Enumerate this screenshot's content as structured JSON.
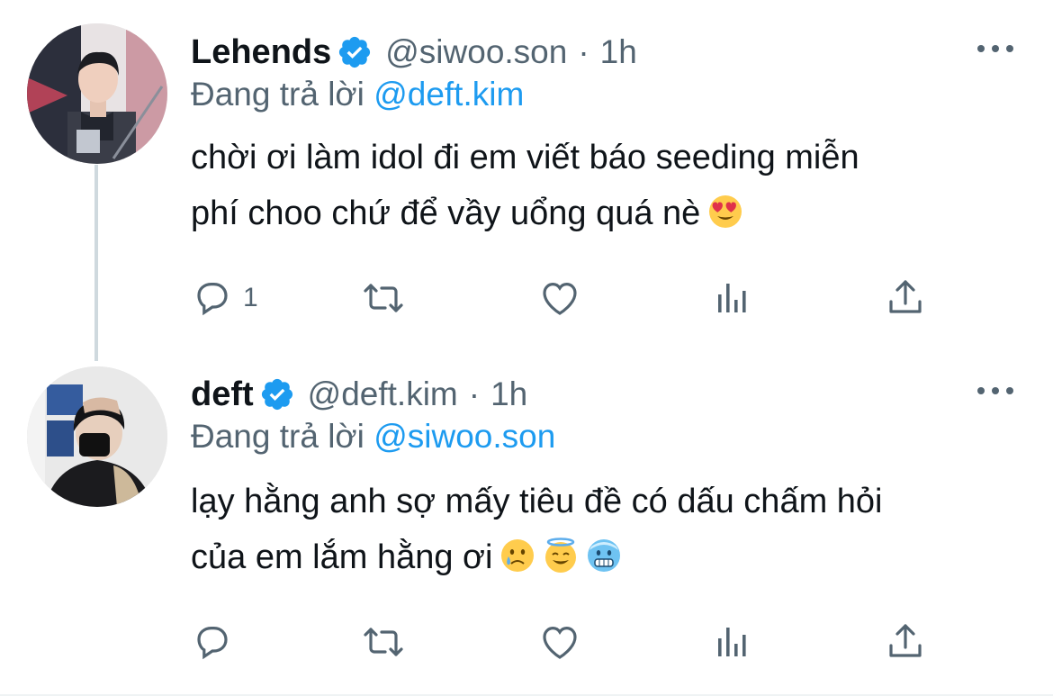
{
  "tweets": [
    {
      "author_name": "Lehends",
      "handle": "@siwoo.son",
      "separator": "·",
      "time": "1h",
      "reply_prefix": "Đang trả lời",
      "reply_to": "@deft.kim",
      "text_lines": [
        "chời ơi làm idol đi em viết báo seeding miễn",
        "phí choo chứ để vầy uổng quá nè"
      ],
      "emojis": [
        "heart-eyes-emoji"
      ],
      "reply_count": "1",
      "retweet_count": "",
      "like_count": ""
    },
    {
      "author_name": "deft",
      "handle": "@deft.kim",
      "separator": "·",
      "time": "1h",
      "reply_prefix": "Đang trả lời",
      "reply_to": "@siwoo.son",
      "text_lines": [
        "lạy hằng anh sợ mấy tiêu đề có dấu chấm hỏi",
        "của em lắm hằng ơi"
      ],
      "emojis": [
        "crying-emoji",
        "halo-emoji",
        "cold-face-emoji"
      ],
      "reply_count": "",
      "retweet_count": "",
      "like_count": ""
    }
  ],
  "colors": {
    "verified": "#1d9bf0",
    "mention": "#1d9bf0",
    "secondary_text": "#536471",
    "primary_text": "#0f1419",
    "thread_line": "#cfd9de"
  },
  "icons": {
    "reply": "reply-icon",
    "retweet": "retweet-icon",
    "like": "heart-icon",
    "stats": "stats-icon",
    "share": "share-icon",
    "more": "more-icon",
    "verified": "verified-badge-icon"
  }
}
